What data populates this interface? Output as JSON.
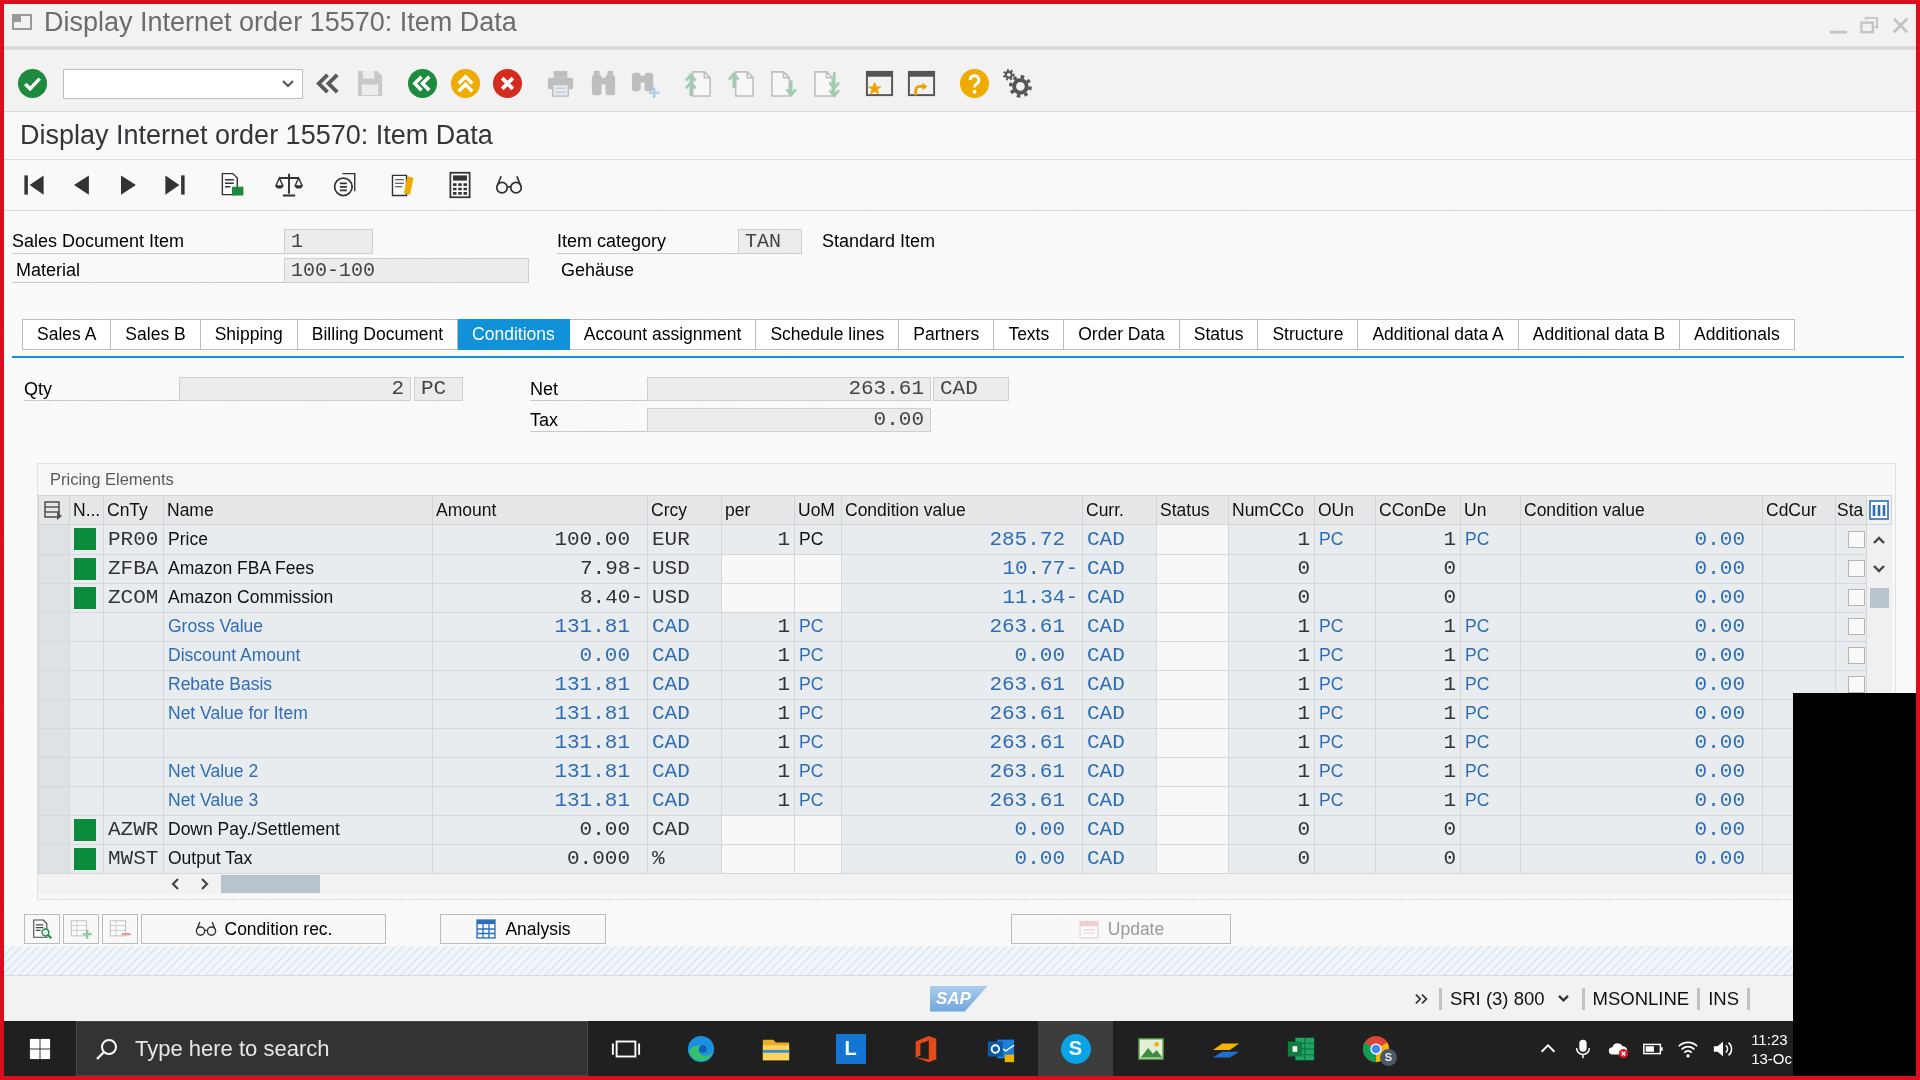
{
  "window": {
    "title": "Display Internet order 15570: Item Data"
  },
  "toolbar": {
    "groups": [
      {
        "items": [
          {
            "kind": "enter",
            "disabled": false
          },
          {
            "kind": "command_field"
          },
          {
            "kind": "collapse",
            "disabled": false
          },
          {
            "kind": "save",
            "disabled": true
          }
        ]
      },
      {
        "items": [
          {
            "kind": "back",
            "disabled": false
          },
          {
            "kind": "exit",
            "disabled": false
          },
          {
            "kind": "cancel",
            "disabled": false
          }
        ]
      },
      {
        "items": [
          {
            "kind": "print",
            "disabled": true
          },
          {
            "kind": "find",
            "disabled": true
          },
          {
            "kind": "find_next",
            "disabled": true
          }
        ]
      },
      {
        "items": [
          {
            "kind": "first_page",
            "disabled": true
          },
          {
            "kind": "previous_page",
            "disabled": true
          },
          {
            "kind": "next_page",
            "disabled": true
          },
          {
            "kind": "last_page",
            "disabled": true
          }
        ]
      },
      {
        "items": [
          {
            "kind": "new_session",
            "disabled": false
          },
          {
            "kind": "shortcut",
            "disabled": false
          }
        ]
      },
      {
        "items": [
          {
            "kind": "help",
            "disabled": false
          },
          {
            "kind": "settings",
            "disabled": false
          }
        ]
      }
    ]
  },
  "screen_title": "Display Internet order 15570: Item Data",
  "header": {
    "sales_document_item": {
      "label": "Sales Document Item",
      "value": "1"
    },
    "item_category": {
      "label": "Item category",
      "value": "TAN",
      "description": "Standard Item"
    },
    "material": {
      "label": "Material",
      "value": "100-100",
      "description": "Gehäuse"
    }
  },
  "tabs": [
    {
      "label": "Sales A",
      "selected": false
    },
    {
      "label": "Sales B",
      "selected": false
    },
    {
      "label": "Shipping",
      "selected": false
    },
    {
      "label": "Billing Document",
      "selected": false
    },
    {
      "label": "Conditions",
      "selected": true
    },
    {
      "label": "Account assignment",
      "selected": false
    },
    {
      "label": "Schedule lines",
      "selected": false
    },
    {
      "label": "Partners",
      "selected": false
    },
    {
      "label": "Texts",
      "selected": false
    },
    {
      "label": "Order Data",
      "selected": false
    },
    {
      "label": "Status",
      "selected": false
    },
    {
      "label": "Structure",
      "selected": false
    },
    {
      "label": "Additional data A",
      "selected": false
    },
    {
      "label": "Additional data B",
      "selected": false
    },
    {
      "label": "Additionals",
      "selected": false
    }
  ],
  "conditions": {
    "qty": {
      "label": "Qty",
      "value": "2",
      "unit": "PC"
    },
    "net": {
      "label": "Net",
      "value": "263.61",
      "currency": "CAD"
    },
    "tax": {
      "label": "Tax",
      "value": "0.00"
    }
  },
  "pricing_elements": {
    "title": "Pricing Elements",
    "columns": [
      {
        "label": "N...",
        "kind": "marker"
      },
      {
        "label": "CnTy",
        "kind": "code"
      },
      {
        "label": "Name",
        "kind": "name"
      },
      {
        "label": "Amount",
        "kind": "amount"
      },
      {
        "label": "Crcy",
        "kind": "unit"
      },
      {
        "label": "per",
        "kind": "count",
        "input_ready": true
      },
      {
        "label": "UoM",
        "kind": "uom",
        "input_ready": true
      },
      {
        "label": "Condition value",
        "kind": "value"
      },
      {
        "label": "Curr.",
        "kind": "currency"
      },
      {
        "label": "Status",
        "kind": "status",
        "input_ready": true
      },
      {
        "label": "NumCCo",
        "kind": "count"
      },
      {
        "label": "OUn",
        "kind": "uom_link"
      },
      {
        "label": "CConDe",
        "kind": "count"
      },
      {
        "label": "Un",
        "kind": "uom_link"
      },
      {
        "label": "Condition value",
        "kind": "value"
      },
      {
        "label": "CdCur",
        "kind": "currency"
      },
      {
        "label": "Sta",
        "kind": "check"
      }
    ],
    "rows": [
      {
        "kind": "condition",
        "marker": true,
        "checked": false,
        "cells": [
          null,
          "PR00",
          "Price",
          "100.00",
          "EUR",
          "1",
          "PC",
          "285.72",
          "CAD",
          null,
          "1",
          "PC",
          "1",
          "PC",
          "0.00",
          null,
          null
        ]
      },
      {
        "kind": "condition",
        "marker": true,
        "checked": false,
        "cells": [
          null,
          "ZFBA",
          "Amazon FBA Fees",
          "7.98-",
          "USD",
          null,
          null,
          "10.77-",
          "CAD",
          null,
          "0",
          null,
          "0",
          null,
          "0.00",
          null,
          null
        ]
      },
      {
        "kind": "condition",
        "marker": true,
        "checked": false,
        "cells": [
          null,
          "ZCOM",
          "Amazon Commission",
          "8.40-",
          "USD",
          null,
          null,
          "11.34-",
          "CAD",
          null,
          "0",
          null,
          "0",
          null,
          "0.00",
          null,
          null
        ]
      },
      {
        "kind": "subtotal",
        "marker": false,
        "checked": false,
        "cells": [
          null,
          null,
          "Gross Value",
          "131.81",
          "CAD",
          "1",
          "PC",
          "263.61",
          "CAD",
          null,
          "1",
          "PC",
          "1",
          "PC",
          "0.00",
          null,
          null
        ]
      },
      {
        "kind": "subtotal",
        "marker": false,
        "checked": false,
        "cells": [
          null,
          null,
          "Discount Amount",
          "0.00",
          "CAD",
          "1",
          "PC",
          "0.00",
          "CAD",
          null,
          "1",
          "PC",
          "1",
          "PC",
          "0.00",
          null,
          null
        ]
      },
      {
        "kind": "subtotal",
        "marker": false,
        "checked": false,
        "cells": [
          null,
          null,
          "Rebate Basis",
          "131.81",
          "CAD",
          "1",
          "PC",
          "263.61",
          "CAD",
          null,
          "1",
          "PC",
          "1",
          "PC",
          "0.00",
          null,
          null
        ]
      },
      {
        "kind": "subtotal",
        "marker": false,
        "cells": [
          null,
          null,
          "Net Value for Item",
          "131.81",
          "CAD",
          "1",
          "PC",
          "263.61",
          "CAD",
          null,
          "1",
          "PC",
          "1",
          "PC",
          "0.00",
          null,
          null
        ]
      },
      {
        "kind": "subtotal",
        "marker": false,
        "cells": [
          null,
          null,
          null,
          "131.81",
          "CAD",
          "1",
          "PC",
          "263.61",
          "CAD",
          null,
          "1",
          "PC",
          "1",
          "PC",
          "0.00",
          null,
          null
        ]
      },
      {
        "kind": "subtotal",
        "marker": false,
        "cells": [
          null,
          null,
          "Net Value 2",
          "131.81",
          "CAD",
          "1",
          "PC",
          "263.61",
          "CAD",
          null,
          "1",
          "PC",
          "1",
          "PC",
          "0.00",
          null,
          null
        ]
      },
      {
        "kind": "subtotal",
        "marker": false,
        "cells": [
          null,
          null,
          "Net Value 3",
          "131.81",
          "CAD",
          "1",
          "PC",
          "263.61",
          "CAD",
          null,
          "1",
          "PC",
          "1",
          "PC",
          "0.00",
          null,
          null
        ]
      },
      {
        "kind": "condition",
        "marker": true,
        "cells": [
          null,
          "AZWR",
          "Down Pay./Settlement",
          "0.00",
          "CAD",
          null,
          null,
          "0.00",
          "CAD",
          null,
          "0",
          null,
          "0",
          null,
          "0.00",
          null,
          null
        ]
      },
      {
        "kind": "condition",
        "marker": true,
        "cells": [
          null,
          "MWST",
          "Output Tax",
          "0.000",
          "%",
          null,
          null,
          "0.00",
          "CAD",
          null,
          "0",
          null,
          "0",
          null,
          "0.00",
          null,
          null
        ]
      }
    ]
  },
  "buttons": [
    {
      "kind": "details",
      "disabled": false
    },
    {
      "kind": "insert_row",
      "disabled": true
    },
    {
      "kind": "delete_row",
      "disabled": true
    },
    {
      "kind": "condition_record",
      "label": "Condition rec.",
      "disabled": false
    },
    {
      "kind": "analysis",
      "label": "Analysis",
      "disabled": false
    },
    {
      "kind": "update",
      "label": "Update",
      "disabled": true
    }
  ],
  "status_bar": {
    "logo": "SAP",
    "system": "SRI (3) 800",
    "server": "MSONLINE",
    "mode": "INS"
  },
  "taskbar": {
    "search": {
      "placeholder": "Type here to search"
    },
    "apps": [
      {
        "kind": "task_view",
        "active": false
      },
      {
        "kind": "edge",
        "active": false
      },
      {
        "kind": "explorer",
        "active": false
      },
      {
        "kind": "letter_tile",
        "glyph": "L",
        "active": false
      },
      {
        "kind": "office",
        "active": false
      },
      {
        "kind": "outlook",
        "active": false
      },
      {
        "kind": "letter_circle",
        "glyph": "S",
        "active": true
      },
      {
        "kind": "picture",
        "active": false
      },
      {
        "kind": "stripes",
        "active": false
      },
      {
        "kind": "excel",
        "active": false
      },
      {
        "kind": "chrome",
        "badge": "S",
        "active": false
      }
    ],
    "time": "11:23",
    "date": "13-Oc"
  }
}
